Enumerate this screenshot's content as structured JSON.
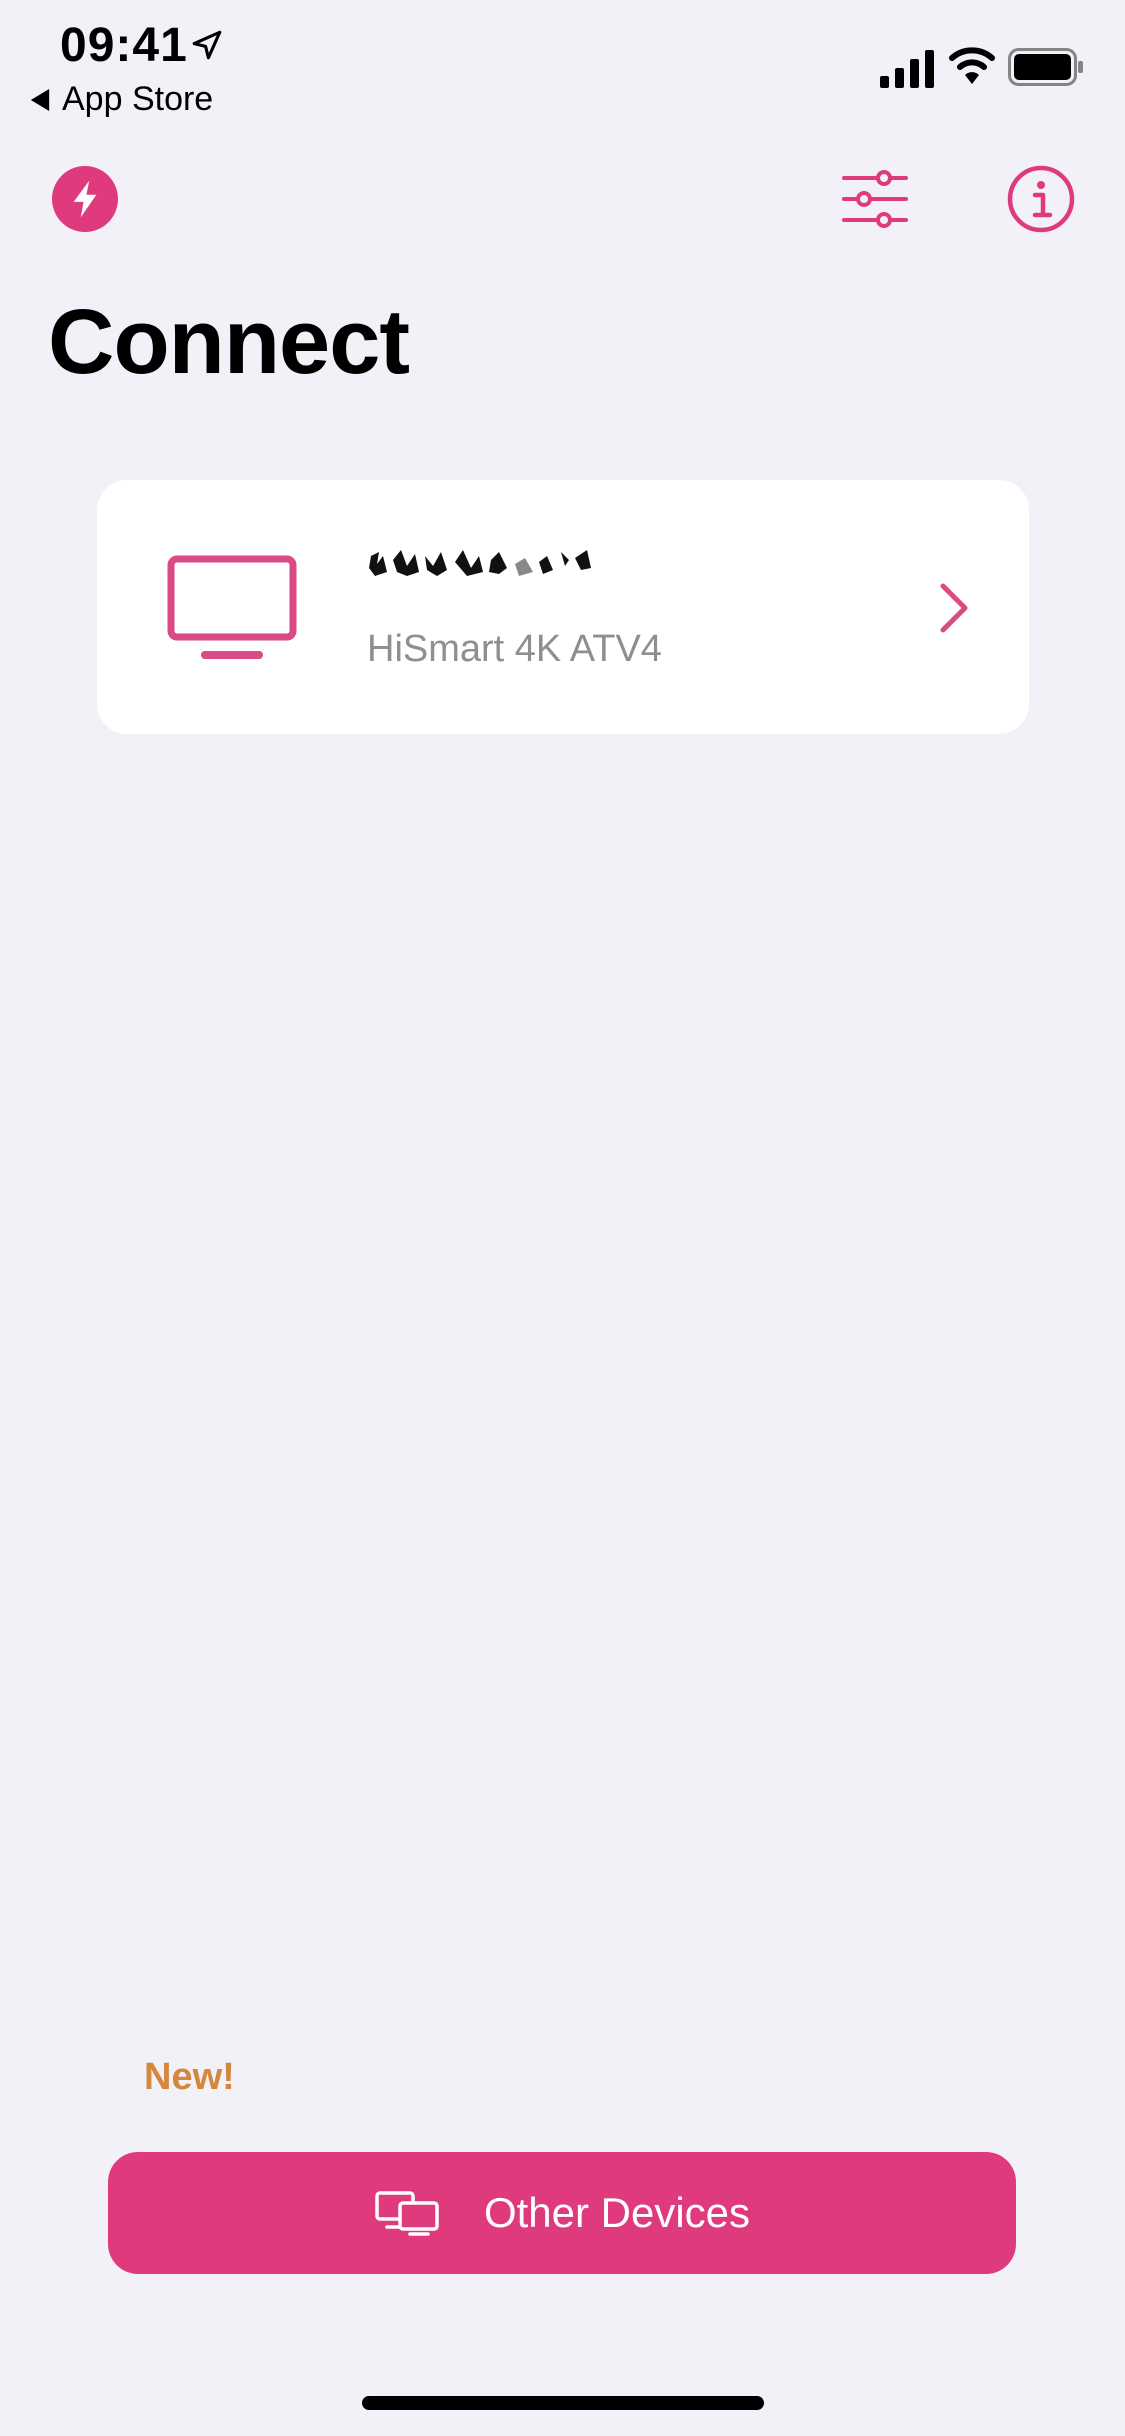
{
  "status_bar": {
    "time": "09:41",
    "back_app": "App Store"
  },
  "nav": {
    "left_icon": "bolt-icon",
    "right_icons": [
      "sliders-icon",
      "info-icon"
    ]
  },
  "page": {
    "title": "Connect"
  },
  "devices": [
    {
      "icon": "tv-icon",
      "model": "HiSmart 4K ATV4"
    }
  ],
  "bottom": {
    "new_badge": "New!",
    "other_devices_label": "Other Devices"
  },
  "colors": {
    "accent": "#e03a7f",
    "background": "#f2f1f7",
    "badge": "#d4873d",
    "secondary_text": "#8e8e93"
  }
}
